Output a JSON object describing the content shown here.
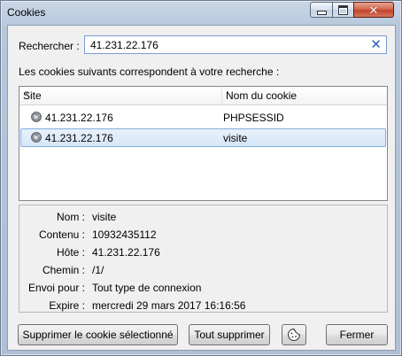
{
  "window": {
    "title": "Cookies",
    "controls": {
      "minimize": "minimize-icon",
      "maximize": "maximize-icon",
      "close": "close-icon"
    }
  },
  "search": {
    "label": "Rechercher :",
    "value": "41.231.22.176",
    "clear_icon": "✕"
  },
  "description": "Les cookies suivants correspondent à votre recherche :",
  "list": {
    "columns": [
      "Site",
      "Nom du cookie"
    ],
    "sort_icon": "sort-ascending-icon",
    "rows": [
      {
        "site": "41.231.22.176",
        "name": "PHPSESSID",
        "selected": false
      },
      {
        "site": "41.231.22.176",
        "name": "visite",
        "selected": true
      }
    ]
  },
  "details": {
    "labels": [
      "Nom :",
      "Contenu :",
      "Hôte :",
      "Chemin :",
      "Envoi pour :",
      "Expire :"
    ],
    "values": [
      "visite",
      "10932435112",
      "41.231.22.176",
      "/1/",
      "Tout type de connexion",
      "mercredi 29 mars 2017 16:16:56"
    ]
  },
  "buttons": {
    "remove_selected": "Supprimer le cookie sélectionné",
    "remove_all": "Tout supprimer",
    "exceptions_icon": "cookie-exceptions-icon",
    "close": "Fermer"
  },
  "colors": {
    "selection": "#d6e6f8",
    "accent": "#2b64b8",
    "close_button": "#c2442a"
  }
}
